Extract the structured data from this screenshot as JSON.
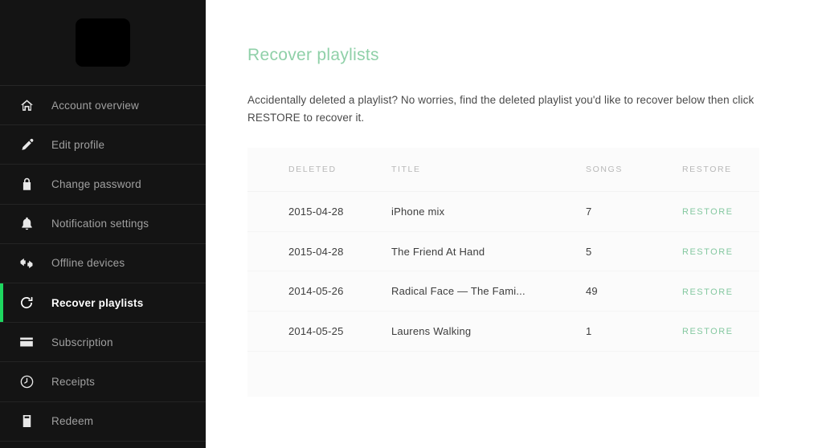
{
  "sidebar": {
    "avatar_name": "profile-avatar-placeholder",
    "accent_color": "#1ed760",
    "items": [
      {
        "label": "Account overview",
        "icon": "home-icon",
        "active": false
      },
      {
        "label": "Edit profile",
        "icon": "pencil-icon",
        "active": false
      },
      {
        "label": "Change password",
        "icon": "lock-icon",
        "active": false
      },
      {
        "label": "Notification settings",
        "icon": "bell-icon",
        "active": false
      },
      {
        "label": "Offline devices",
        "icon": "offline-device-icon",
        "active": false
      },
      {
        "label": "Recover playlists",
        "icon": "refresh-icon",
        "active": true
      },
      {
        "label": "Subscription",
        "icon": "credit-card-icon",
        "active": false
      },
      {
        "label": "Receipts",
        "icon": "clock-icon",
        "active": false
      },
      {
        "label": "Redeem",
        "icon": "ticket-icon",
        "active": false
      }
    ]
  },
  "main": {
    "title": "Recover playlists",
    "title_color": "#8fd0a8",
    "description": "Accidentally deleted a playlist? No worries, find the deleted playlist you'd like to recover below then click RESTORE to recover it.",
    "table": {
      "headers": {
        "deleted": "DELETED",
        "title": "TITLE",
        "songs": "SONGS",
        "restore": "RESTORE"
      },
      "restore_label": "RESTORE",
      "restore_color": "#84c8a0",
      "rows": [
        {
          "deleted": "2015-04-28",
          "title": "iPhone mix",
          "songs": "7",
          "restore": "RESTORE"
        },
        {
          "deleted": "2015-04-28",
          "title": "The Friend At Hand",
          "songs": "5",
          "restore": "RESTORE"
        },
        {
          "deleted": "2014-05-26",
          "title": "Radical Face — The Fami...",
          "songs": "49",
          "restore": "RESTORE"
        },
        {
          "deleted": "2014-05-25",
          "title": "Laurens Walking",
          "songs": "1",
          "restore": "RESTORE"
        }
      ]
    }
  }
}
